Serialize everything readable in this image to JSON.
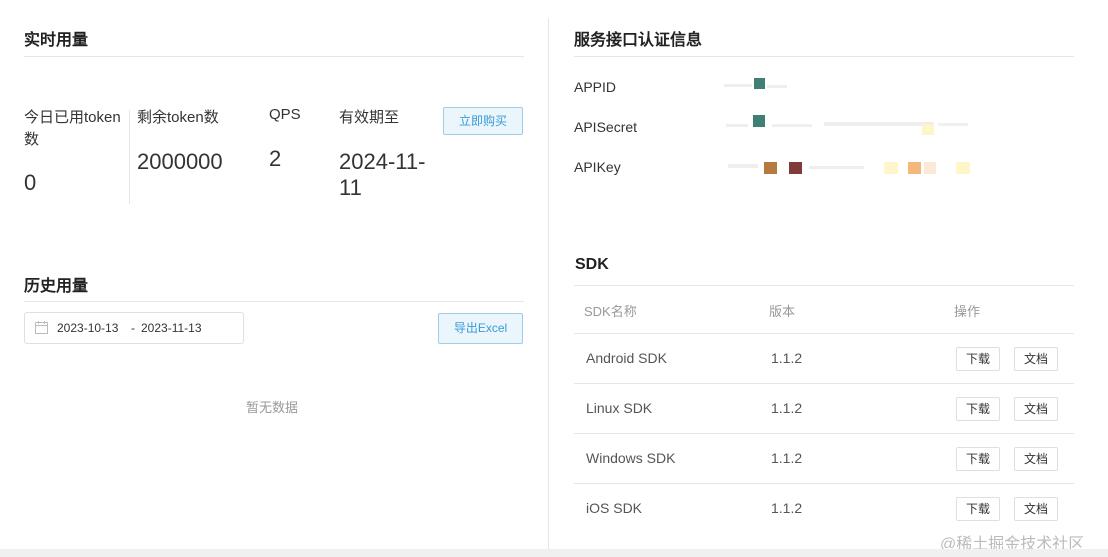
{
  "realtime": {
    "title": "实时用量",
    "stats": [
      {
        "label": "今日已用token数",
        "value": "0"
      },
      {
        "label": "剩余token数",
        "value": "2000000"
      },
      {
        "label": "QPS",
        "value": "2"
      },
      {
        "label": "有效期至",
        "value": "2024-11-11"
      }
    ],
    "buy_button": "立即购买"
  },
  "history": {
    "title": "历史用量",
    "date_start": "2023-10-13",
    "date_sep": "-",
    "date_end": "2023-11-13",
    "export_button": "导出Excel",
    "empty_text": "暂无数据"
  },
  "auth": {
    "title": "服务接口认证信息",
    "rows": [
      {
        "label": "APPID"
      },
      {
        "label": "APISecret"
      },
      {
        "label": "APIKey"
      }
    ],
    "mask_colors": [
      "#3f7f74",
      "#b57a3f",
      "#7f3a3a",
      "#f7e8b0",
      "#f5b87a",
      "#fff6c8"
    ]
  },
  "sdk": {
    "title": "SDK",
    "headers": {
      "name": "SDK名称",
      "version": "版本",
      "action": "操作"
    },
    "rows": [
      {
        "name": "Android SDK",
        "version": "1.1.2",
        "download": "下载",
        "docs": "文档"
      },
      {
        "name": "Linux SDK",
        "version": "1.1.2",
        "download": "下载",
        "docs": "文档"
      },
      {
        "name": "Windows SDK",
        "version": "1.1.2",
        "download": "下载",
        "docs": "文档"
      },
      {
        "name": "iOS SDK",
        "version": "1.1.2",
        "download": "下载",
        "docs": "文档"
      }
    ]
  },
  "watermark": "@稀土掘金技术社区"
}
